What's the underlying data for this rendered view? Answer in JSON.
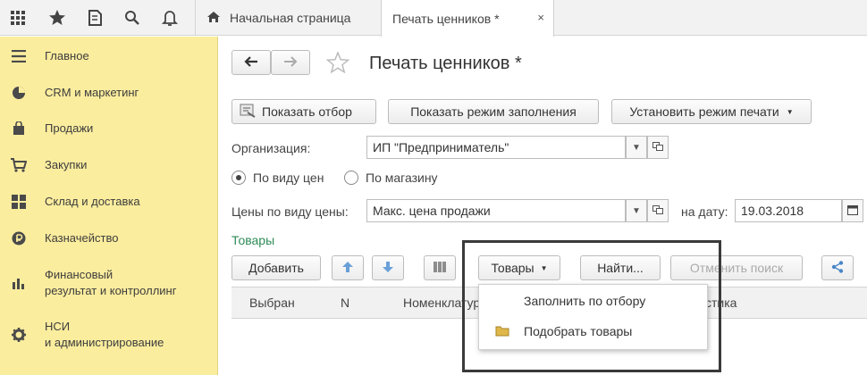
{
  "tabs": {
    "home": "Начальная страница",
    "active": "Печать ценников *",
    "close": "×"
  },
  "sidebar": {
    "items": [
      {
        "label": "Главное",
        "icon": "menu-icon"
      },
      {
        "label": "CRM и маркетинг",
        "icon": "pie-chart-icon"
      },
      {
        "label": "Продажи",
        "icon": "shopping-bag-icon"
      },
      {
        "label": "Закупки",
        "icon": "cart-icon"
      },
      {
        "label": "Склад и доставка",
        "icon": "warehouse-icon"
      },
      {
        "label": "Казначейство",
        "icon": "coin-icon"
      },
      {
        "label": "Финансовый результат и контроллинг",
        "line1": "Финансовый",
        "line2": "результат и контроллинг",
        "icon": "bar-chart-icon"
      },
      {
        "label": "НСИ и администрирование",
        "line1": "НСИ",
        "line2": "и администрирование",
        "icon": "gear-icon"
      }
    ]
  },
  "form": {
    "title": "Печать ценников *",
    "show_filter": "Показать отбор",
    "show_fill_mode": "Показать режим заполнения",
    "set_print_mode": "Установить режим печати",
    "org_label": "Организация:",
    "org_value": "ИП \"Предприниматель\"",
    "radio_price_type": "По виду цен",
    "radio_store": "По магазину",
    "prices_label": "Цены по виду цены:",
    "prices_value": "Макс. цена продажи",
    "date_label": "на дату:",
    "date_value": "19.03.2018",
    "goods_section": "Товары",
    "add_button": "Добавить",
    "goods_button": "Товары",
    "find_button": "Найти...",
    "cancel_search": "Отменить поиск"
  },
  "table": {
    "columns": [
      "Выбран",
      "N",
      "Номенклатура",
      "стика"
    ]
  },
  "dropdown": {
    "items": [
      "Заполнить по отбору",
      "Подобрать товары"
    ]
  }
}
